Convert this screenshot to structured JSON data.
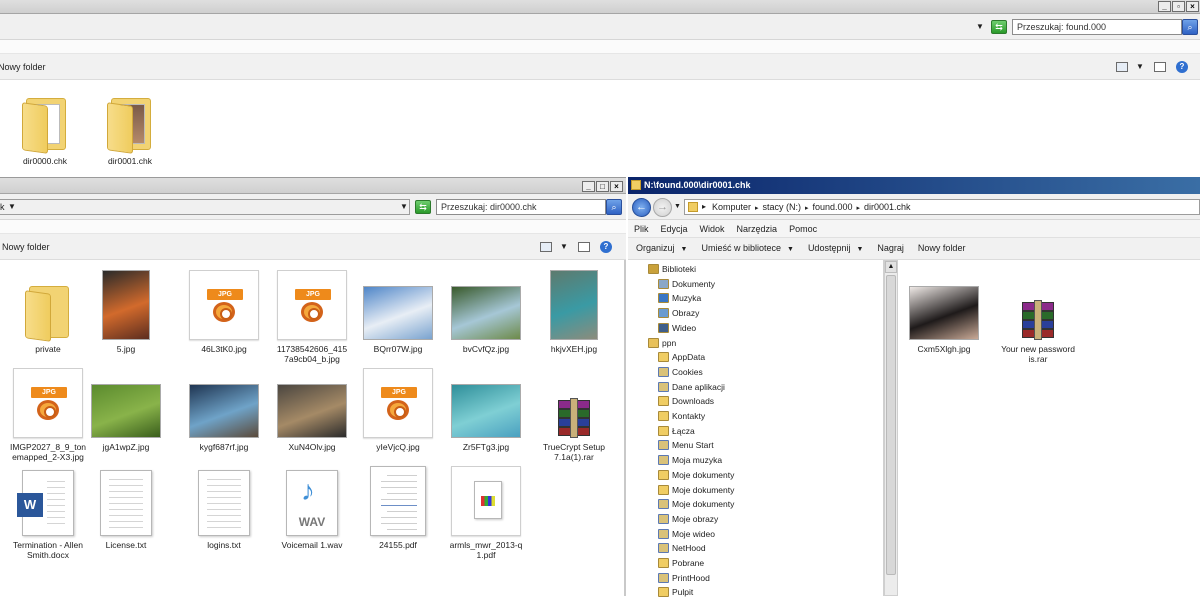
{
  "top_window": {
    "search_placeholder": "Przeszukaj: found.000",
    "new_folder": "Nowy folder",
    "files": [
      {
        "name": "dir0000.chk",
        "kind": "folder-doc"
      },
      {
        "name": "dir0001.chk",
        "kind": "folder-photo"
      }
    ]
  },
  "left_window": {
    "address_fragment": "k",
    "search_placeholder": "Przeszukaj: dir0000.chk",
    "new_folder": "Nowy folder",
    "files": [
      {
        "name": "private",
        "kind": "folder"
      },
      {
        "name": "5.jpg",
        "kind": "photo",
        "colors": [
          "#2a2a2a",
          "#d26a2c",
          "#5c2d1f"
        ]
      },
      {
        "name": "46L3tK0.jpg",
        "kind": "jpg"
      },
      {
        "name": "11738542606_415\n7a9cb04_b.jpg",
        "kind": "jpg"
      },
      {
        "name": "BQrr07W.jpg",
        "kind": "photo",
        "colors": [
          "#4f86c8",
          "#e8eef5",
          "#7aa3cf"
        ]
      },
      {
        "name": "bvCvfQz.jpg",
        "kind": "photo",
        "colors": [
          "#395a2b",
          "#a6c7d6",
          "#6d8a4a"
        ]
      },
      {
        "name": "hkjvXEH.jpg",
        "kind": "photo",
        "colors": [
          "#5d7a6e",
          "#3a9aa4",
          "#8c8c7c"
        ]
      },
      {
        "name": "IMGP2027_8_9_ton\nemapped_2-X3.jpg",
        "kind": "jpg"
      },
      {
        "name": "jgA1wpZ.jpg",
        "kind": "photo",
        "colors": [
          "#5b8b2e",
          "#89b34a",
          "#3a5e1c"
        ]
      },
      {
        "name": "kygf687rf.jpg",
        "kind": "photo",
        "colors": [
          "#1f3552",
          "#6fa3c8",
          "#5b4a3a"
        ]
      },
      {
        "name": "XuN4Olv.jpg",
        "kind": "photo",
        "colors": [
          "#4b4640",
          "#a58a66",
          "#2b2b2b"
        ]
      },
      {
        "name": "yIeVjcQ.jpg",
        "kind": "jpg"
      },
      {
        "name": "Zr5FTg3.jpg",
        "kind": "photo",
        "colors": [
          "#2f8f9a",
          "#7fcfd4",
          "#4aa0c0"
        ]
      },
      {
        "name": "TrueCrypt Setup\n7.1a(1).rar",
        "kind": "rar"
      },
      {
        "name": "Termination - Allen\nSmith.docx",
        "kind": "word"
      },
      {
        "name": "License.txt",
        "kind": "txt"
      },
      {
        "name": "logins.txt",
        "kind": "txt"
      },
      {
        "name": "Voicemail 1.wav",
        "kind": "wav"
      },
      {
        "name": "24155.pdf",
        "kind": "pdf"
      },
      {
        "name": "armls_mwr_2013-q\n1.pdf",
        "kind": "pdf2"
      }
    ]
  },
  "right_window": {
    "title": "N:\\found.000\\dir0001.chk",
    "breadcrumb": [
      "Komputer",
      "stacy (N:)",
      "found.000",
      "dir0001.chk"
    ],
    "menu": [
      "Plik",
      "Edycja",
      "Widok",
      "Narzędzia",
      "Pomoc"
    ],
    "toolbar": [
      "Organizuj",
      "Umieść w bibliotece",
      "Udostępnij",
      "Nagraj",
      "Nowy folder"
    ],
    "nav": [
      {
        "label": "Biblioteki",
        "icon": "library-icon",
        "indent": 0,
        "color": "#c9a13a"
      },
      {
        "label": "Dokumenty",
        "icon": "documents-icon",
        "indent": 1,
        "color": "#8aa7c8"
      },
      {
        "label": "Muzyka",
        "icon": "music-icon",
        "indent": 1,
        "color": "#3a76c4"
      },
      {
        "label": "Obrazy",
        "icon": "pictures-icon",
        "indent": 1,
        "color": "#6b9bd0"
      },
      {
        "label": "Wideo",
        "icon": "video-icon",
        "indent": 1,
        "color": "#3f5f8a"
      },
      {
        "label": "ppn",
        "icon": "user-folder-icon",
        "indent": 0,
        "color": "#e8c15a"
      },
      {
        "label": "AppData",
        "icon": "folder-icon",
        "indent": 1,
        "color": "#f0cd63"
      },
      {
        "label": "Cookies",
        "icon": "shortcut-folder-icon",
        "indent": 1,
        "color": "#d9c27a"
      },
      {
        "label": "Dane aplikacji",
        "icon": "shortcut-folder-icon",
        "indent": 1,
        "color": "#d9c27a"
      },
      {
        "label": "Downloads",
        "icon": "folder-icon",
        "indent": 1,
        "color": "#f0cd63"
      },
      {
        "label": "Kontakty",
        "icon": "folder-icon",
        "indent": 1,
        "color": "#f0cd63"
      },
      {
        "label": "Łącza",
        "icon": "folder-icon",
        "indent": 1,
        "color": "#f0cd63"
      },
      {
        "label": "Menu Start",
        "icon": "shortcut-folder-icon",
        "indent": 1,
        "color": "#d9c27a"
      },
      {
        "label": "Moja muzyka",
        "icon": "shortcut-folder-icon",
        "indent": 1,
        "color": "#d9c27a"
      },
      {
        "label": "Moje dokumenty",
        "icon": "folder-icon",
        "indent": 1,
        "color": "#f0cd63"
      },
      {
        "label": "Moje dokumenty",
        "icon": "folder-icon",
        "indent": 1,
        "color": "#f0cd63"
      },
      {
        "label": "Moje dokumenty",
        "icon": "shortcut-folder-icon",
        "indent": 1,
        "color": "#d9c27a"
      },
      {
        "label": "Moje obrazy",
        "icon": "shortcut-folder-icon",
        "indent": 1,
        "color": "#d9c27a"
      },
      {
        "label": "Moje wideo",
        "icon": "shortcut-folder-icon",
        "indent": 1,
        "color": "#d9c27a"
      },
      {
        "label": "NetHood",
        "icon": "shortcut-folder-icon",
        "indent": 1,
        "color": "#d9c27a"
      },
      {
        "label": "Pobrane",
        "icon": "folder-icon",
        "indent": 1,
        "color": "#f0cd63"
      },
      {
        "label": "PrintHood",
        "icon": "shortcut-folder-icon",
        "indent": 1,
        "color": "#d9c27a"
      },
      {
        "label": "Pulpit",
        "icon": "folder-icon",
        "indent": 1,
        "color": "#f0cd63"
      }
    ],
    "files": [
      {
        "name": "Cxm5Xlgh.jpg",
        "kind": "photo",
        "colors": [
          "#efe9e6",
          "#1e1a1a",
          "#c9a996"
        ]
      },
      {
        "name": "Your new password\nis.rar",
        "kind": "rar"
      }
    ]
  },
  "colors": {
    "accent": "#2f62c4",
    "selection_title": "#0a246a"
  }
}
